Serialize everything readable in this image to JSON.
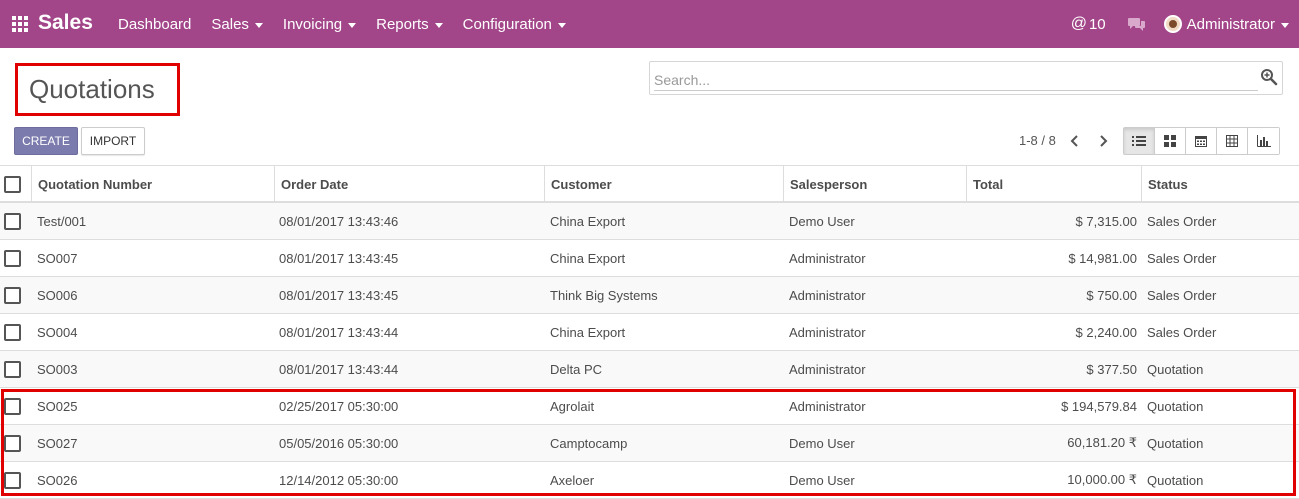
{
  "navbar": {
    "brand": "Sales",
    "menu": [
      {
        "label": "Dashboard",
        "dropdown": false
      },
      {
        "label": "Sales",
        "dropdown": true
      },
      {
        "label": "Invoicing",
        "dropdown": true
      },
      {
        "label": "Reports",
        "dropdown": true
      },
      {
        "label": "Configuration",
        "dropdown": true
      }
    ],
    "mentions_count": "10",
    "user_name": "Administrator",
    "color": "#a24689"
  },
  "control_panel": {
    "title": "Quotations",
    "search_placeholder": "Search...",
    "create_label": "CREATE",
    "import_label": "IMPORT",
    "pager": "1-8 / 8",
    "views": [
      "list-view-icon",
      "kanban-view-icon",
      "calendar-view-icon",
      "pivot-view-icon",
      "graph-view-icon"
    ],
    "active_view": "list-view-icon"
  },
  "table": {
    "columns": [
      "Quotation Number",
      "Order Date",
      "Customer",
      "Salesperson",
      "Total",
      "Status"
    ],
    "rows": [
      {
        "number": "Test/001",
        "date": "08/01/2017 13:43:46",
        "customer": "China Export",
        "salesperson": "Demo User",
        "total": "$ 7,315.00",
        "status": "Sales Order"
      },
      {
        "number": "SO007",
        "date": "08/01/2017 13:43:45",
        "customer": "China Export",
        "salesperson": "Administrator",
        "total": "$ 14,981.00",
        "status": "Sales Order"
      },
      {
        "number": "SO006",
        "date": "08/01/2017 13:43:45",
        "customer": "Think Big Systems",
        "salesperson": "Administrator",
        "total": "$ 750.00",
        "status": "Sales Order"
      },
      {
        "number": "SO004",
        "date": "08/01/2017 13:43:44",
        "customer": "China Export",
        "salesperson": "Administrator",
        "total": "$ 2,240.00",
        "status": "Sales Order"
      },
      {
        "number": "SO003",
        "date": "08/01/2017 13:43:44",
        "customer": "Delta PC",
        "salesperson": "Administrator",
        "total": "$ 377.50",
        "status": "Quotation"
      },
      {
        "number": "SO025",
        "date": "02/25/2017 05:30:00",
        "customer": "Agrolait",
        "salesperson": "Administrator",
        "total": "$ 194,579.84",
        "status": "Quotation"
      },
      {
        "number": "SO027",
        "date": "05/05/2016 05:30:00",
        "customer": "Camptocamp",
        "salesperson": "Demo User",
        "total": "60,181.20 ₹",
        "status": "Quotation"
      },
      {
        "number": "SO026",
        "date": "12/14/2012 05:30:00",
        "customer": "Axeloer",
        "salesperson": "Demo User",
        "total": "10,000.00 ₹",
        "status": "Quotation"
      }
    ]
  },
  "annotation_color": "#e00000"
}
